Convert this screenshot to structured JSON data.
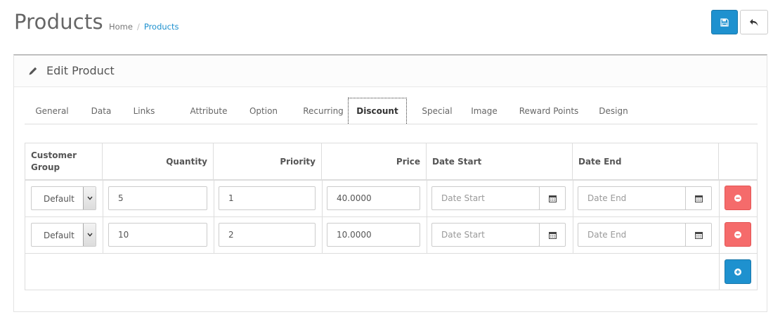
{
  "header": {
    "title": "Products",
    "breadcrumb": [
      "Home",
      "Products"
    ],
    "save_icon": "floppy-disk-icon",
    "back_icon": "reply-arrow-icon"
  },
  "panel": {
    "icon": "pencil-icon",
    "title": "Edit Product"
  },
  "tabs": [
    "General",
    "Data",
    "Links",
    "Attribute",
    "Option",
    "Recurring",
    "Discount",
    "Special",
    "Image",
    "Reward Points",
    "Design"
  ],
  "active_tab": "Discount",
  "table": {
    "headers": {
      "customer_group_1": "Customer",
      "customer_group_2": "Group",
      "quantity": "Quantity",
      "priority": "Priority",
      "price": "Price",
      "date_start": "Date Start",
      "date_end": "Date End"
    },
    "rows": [
      {
        "customer_group": "Default",
        "quantity": "5",
        "priority": "1",
        "price": "40.0000",
        "date_start_placeholder": "Date Start",
        "date_end_placeholder": "Date End"
      },
      {
        "customer_group": "Default",
        "quantity": "10",
        "priority": "2",
        "price": "10.0000",
        "date_start_placeholder": "Date Start",
        "date_end_placeholder": "Date End"
      }
    ]
  },
  "colors": {
    "primary": "#1e91cf",
    "danger": "#f56b6b",
    "breadcrumb_active": "#1e91cf"
  }
}
